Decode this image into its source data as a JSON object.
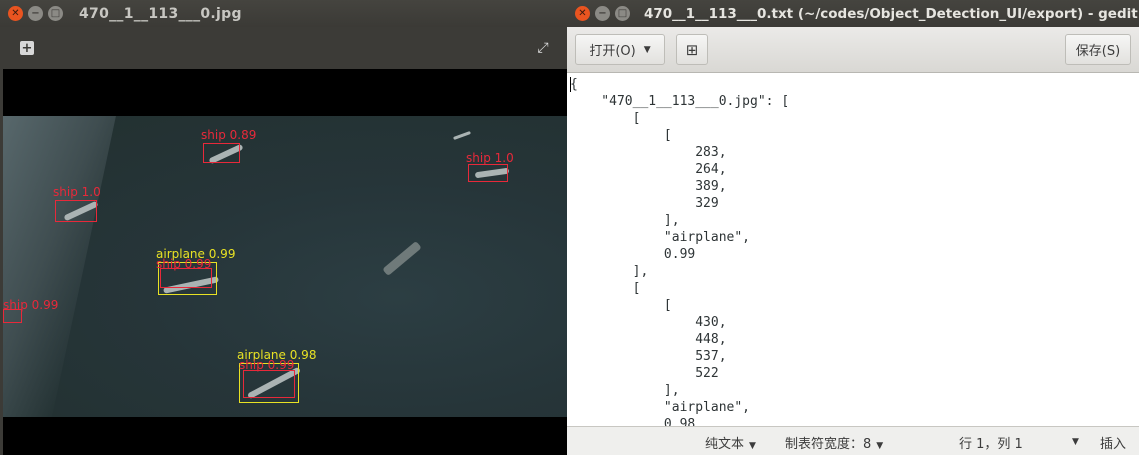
{
  "viewer": {
    "title": "470__1__113___0.jpg",
    "add_icon": "plus-box-icon",
    "fullscreen_icon": "expand-arrows-icon",
    "detections": [
      {
        "label": "ship 0.89",
        "color": "red"
      },
      {
        "label": "ship 1.0",
        "color": "red"
      },
      {
        "label": "ship 1.0",
        "color": "red"
      },
      {
        "label": "airplane 0.99",
        "color": "yellow"
      },
      {
        "label": "ship 0.99",
        "color": "red"
      },
      {
        "label": "ship 0.99",
        "color": "red"
      },
      {
        "label": "airplane 0.98",
        "color": "yellow"
      },
      {
        "label": "ship 0.99",
        "color": "red"
      }
    ]
  },
  "gedit": {
    "title": "470__1__113___0.txt (~/codes/Object_Detection_UI/export) - gedit",
    "open_label": "打开(O)",
    "new_tab_icon": "new-tab-icon",
    "save_label": "保存(S)",
    "content": "{\n    \"470__1__113___0.jpg\": [\n        [\n            [\n                283,\n                264,\n                389,\n                329\n            ],\n            \"airplane\",\n            0.99\n        ],\n        [\n            [\n                430,\n                448,\n                537,\n                522\n            ],\n            \"airplane\",\n            0.98",
    "status": {
      "syntax": "纯文本",
      "tab_width": "制表符宽度：8",
      "position": "行 1，列 1",
      "mode": "插入"
    }
  },
  "colors": {
    "box_red": "#e8293a",
    "box_yellow": "#e8e224",
    "ubuntu_close": "#e95420"
  }
}
